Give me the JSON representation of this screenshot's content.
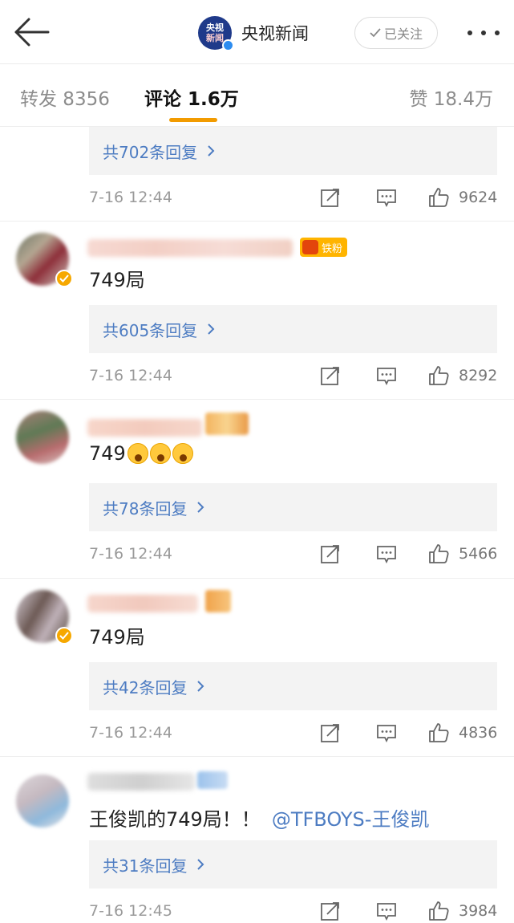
{
  "header": {
    "back_icon": "arrow-left-icon",
    "account_name": "央视新闻",
    "logo_text_line1": "央视",
    "logo_text_line2": "新闻",
    "follow_label": "已关注",
    "more_icon": "more-dots-icon",
    "colors": {
      "logo_bg": "#1f3a8a",
      "verified": "#2d8cf0"
    }
  },
  "tabs": [
    {
      "label": "转发 8356",
      "active": false
    },
    {
      "label": "评论 1.6万",
      "active": true
    },
    {
      "label": "赞 18.4万",
      "active": false
    }
  ],
  "colors": {
    "accent": "#f29b00",
    "link": "#4d7cc2",
    "gold_badge": "#ffb400"
  },
  "comments": [
    {
      "replies": "共702条回复",
      "time": "7-16 12:44",
      "likes": "9624"
    },
    {
      "fan_badge": "铁粉",
      "text": "749局",
      "replies": "共605条回复",
      "time": "7-16 12:44",
      "likes": "8292"
    },
    {
      "text": "749",
      "emoji_count": 3,
      "replies": "共78条回复",
      "time": "7-16 12:44",
      "likes": "5466"
    },
    {
      "text": "749局",
      "replies": "共42条回复",
      "time": "7-16 12:44",
      "likes": "4836"
    },
    {
      "text": "王俊凯的749局！！",
      "mention": "@TFBOYS-王俊凯",
      "replies": "共31条回复",
      "time": "7-16 12:45",
      "likes": "3984"
    }
  ]
}
